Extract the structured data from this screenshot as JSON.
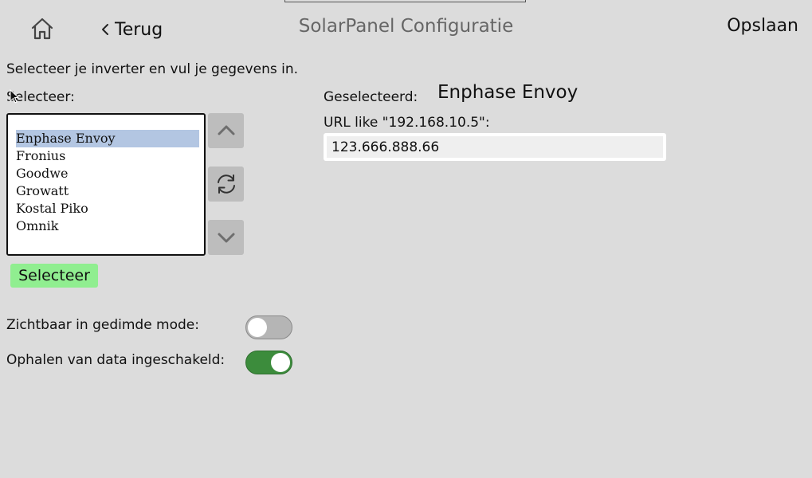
{
  "header": {
    "back_label": "Terug",
    "title": "SolarPanel Configuratie",
    "save_label": "Opslaan",
    "home_icon": "home-icon",
    "back_icon": "chevron-left-icon"
  },
  "form": {
    "intro": "Selecteer je inverter en vul je gegevens in.",
    "select_label": "Selecteer:",
    "inverters": [
      {
        "label": "Enphase Envoy",
        "selected": true
      },
      {
        "label": "Fronius",
        "selected": false
      },
      {
        "label": "Goodwe",
        "selected": false
      },
      {
        "label": "Growatt",
        "selected": false
      },
      {
        "label": "Kostal Piko",
        "selected": false
      },
      {
        "label": "Omnik",
        "selected": false
      }
    ],
    "scroll_up_icon": "chevron-up-icon",
    "refresh_icon": "refresh-icon",
    "scroll_down_icon": "chevron-down-icon",
    "select_button": "Selecteer",
    "selected_caption": "Geselecteerd:",
    "selected_value": "Enphase Envoy",
    "url_label": "URL like \"192.168.10.5\":",
    "url_value": "123.666.888.66"
  },
  "toggles": [
    {
      "label": "Zichtbaar in gedimde mode:",
      "on": false
    },
    {
      "label": "Ophalen van data ingeschakeld:",
      "on": true
    }
  ],
  "colors": {
    "background": "#dcdcdc",
    "selected_item": "#b3c6e2",
    "select_button": "#90ee90",
    "toggle_on": "#3c8c3c",
    "toggle_off": "#b5b5b5"
  }
}
